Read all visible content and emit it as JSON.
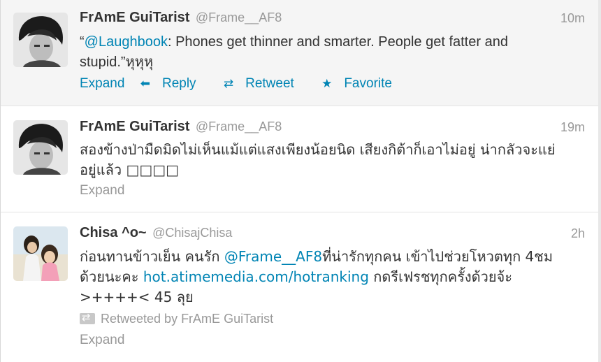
{
  "tweets": [
    {
      "fullname": "FrAmE GuiTarist",
      "username": "@Frame__AF8",
      "time": "10m",
      "text_prefix": "“",
      "mention": "@Laughbook",
      "text_rest": ": Phones get thinner and smarter. People get fatter and stupid.”หุหุหุ",
      "actions": {
        "expand": "Expand",
        "reply": "Reply",
        "retweet": "Retweet",
        "favorite": "Favorite"
      }
    },
    {
      "fullname": "FrAmE GuiTarist",
      "username": "@Frame__AF8",
      "time": "19m",
      "text": "สองข้างป่ามืดมิดไม่เห็นแม้แต่แสงเพียงน้อยนิด เสียงกิต้าก็เอาไม่อยู่ น่ากลัวจะแย่อยู่แล้ว □□□□",
      "expand": "Expand"
    },
    {
      "fullname": "Chisa ^o~",
      "username": "@ChisajChisa",
      "time": "2h",
      "text_a": "ก่อนทานข้าวเย็น คนรัก ",
      "mention": "@Frame__AF8",
      "text_b": "ที่น่ารักทุกคน เข้าไปช่วยโหวตทุก 4ชมด้วยนะคะ ",
      "link": "hot.atimemedia.com/hotranking",
      "text_c": " กดรีเฟรชทุกครั้งด้วยจ้ะ >++++< 45 ลุย",
      "retweeted_by": "Retweeted by FrAmE GuiTarist",
      "expand": "Expand"
    }
  ],
  "colors": {
    "link": "#0084b4",
    "meta": "#999999",
    "text": "#333333",
    "hover_bg": "#f5f5f5"
  }
}
